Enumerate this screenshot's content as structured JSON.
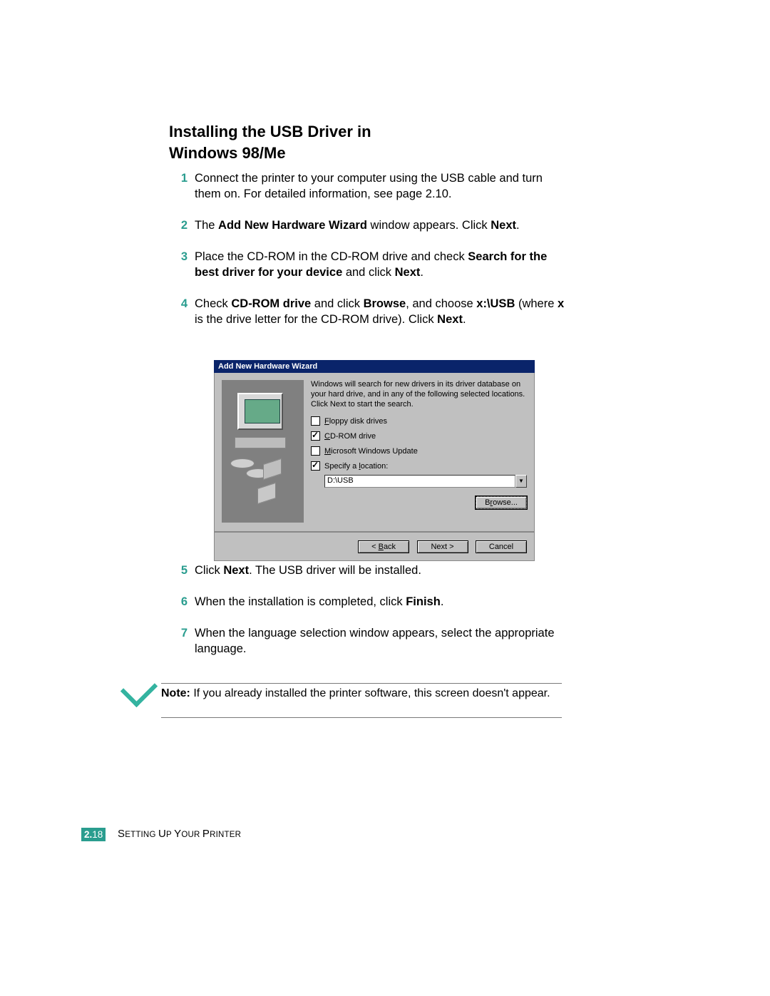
{
  "heading": {
    "line1": "Installing the USB Driver in",
    "line2": "Windows 98/Me"
  },
  "steps": {
    "s1": {
      "num": "1",
      "t1": "Connect the printer to your computer using the USB cable and turn them on. For detailed information, see page 2.10."
    },
    "s2": {
      "num": "2",
      "t1": "The ",
      "b1": "Add New Hardware Wizard",
      "t2": " window appears. Click ",
      "b2": "Next",
      "t3": "."
    },
    "s3": {
      "num": "3",
      "t1": "Place the CD-ROM in the CD-ROM drive and check ",
      "b1": "Search for the best driver for your device",
      "t2": " and click ",
      "b2": "Next",
      "t3": "."
    },
    "s4": {
      "num": "4",
      "t1": "Check ",
      "b1": "CD-ROM drive",
      "t2": " and click ",
      "b2": "Browse",
      "t3": ", and choose ",
      "b3": "x:\\USB",
      "t4": " (where ",
      "b4": "x",
      "t5": " is the drive letter for the CD-ROM drive). Click ",
      "b5": "Next",
      "t6": "."
    },
    "s5": {
      "num": "5",
      "t1": "Click ",
      "b1": "Next",
      "t2": ". The USB driver will be installed."
    },
    "s6": {
      "num": "6",
      "t1": "When the installation is completed, click ",
      "b1": "Finish",
      "t2": "."
    },
    "s7": {
      "num": "7",
      "t1": "When the language selection window appears, select the appropriate language."
    }
  },
  "wizard": {
    "title": "Add New Hardware Wizard",
    "desc": "Windows will search for new drivers in its driver database on your hard drive, and in any of the following selected locations. Click Next to start the search.",
    "floppy_pre": "F",
    "floppy_rest": "loppy disk drives",
    "cdrom_pre": "C",
    "cdrom_rest": "D-ROM drive",
    "winupd_pre": "M",
    "winupd_rest": "icrosoft Windows Update",
    "specify_pre": "Specify a ",
    "specify_u": "l",
    "specify_rest": "ocation:",
    "location_value": "D:\\USB",
    "browse_pre": "B",
    "browse_u": "r",
    "browse_rest": "owse...",
    "back_pre": "< ",
    "back_u": "B",
    "back_rest": "ack",
    "next": "Next >",
    "cancel": "Cancel"
  },
  "note": {
    "label": "Note:",
    "text": " If you already installed the printer software, this screen doesn't appear."
  },
  "footer": {
    "section": "2.",
    "page": "18",
    "chapter1": "S",
    "chapter2": "ETTING ",
    "chapter3": "U",
    "chapter4": "P ",
    "chapter5": "Y",
    "chapter6": "OUR ",
    "chapter7": "P",
    "chapter8": "RINTER"
  }
}
